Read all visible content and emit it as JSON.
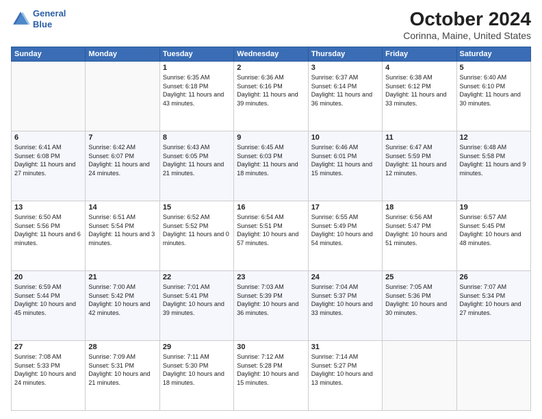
{
  "header": {
    "logo_line1": "General",
    "logo_line2": "Blue",
    "month": "October 2024",
    "location": "Corinna, Maine, United States"
  },
  "weekdays": [
    "Sunday",
    "Monday",
    "Tuesday",
    "Wednesday",
    "Thursday",
    "Friday",
    "Saturday"
  ],
  "weeks": [
    [
      {
        "day": "",
        "info": ""
      },
      {
        "day": "",
        "info": ""
      },
      {
        "day": "1",
        "info": "Sunrise: 6:35 AM\nSunset: 6:18 PM\nDaylight: 11 hours and 43 minutes."
      },
      {
        "day": "2",
        "info": "Sunrise: 6:36 AM\nSunset: 6:16 PM\nDaylight: 11 hours and 39 minutes."
      },
      {
        "day": "3",
        "info": "Sunrise: 6:37 AM\nSunset: 6:14 PM\nDaylight: 11 hours and 36 minutes."
      },
      {
        "day": "4",
        "info": "Sunrise: 6:38 AM\nSunset: 6:12 PM\nDaylight: 11 hours and 33 minutes."
      },
      {
        "day": "5",
        "info": "Sunrise: 6:40 AM\nSunset: 6:10 PM\nDaylight: 11 hours and 30 minutes."
      }
    ],
    [
      {
        "day": "6",
        "info": "Sunrise: 6:41 AM\nSunset: 6:08 PM\nDaylight: 11 hours and 27 minutes."
      },
      {
        "day": "7",
        "info": "Sunrise: 6:42 AM\nSunset: 6:07 PM\nDaylight: 11 hours and 24 minutes."
      },
      {
        "day": "8",
        "info": "Sunrise: 6:43 AM\nSunset: 6:05 PM\nDaylight: 11 hours and 21 minutes."
      },
      {
        "day": "9",
        "info": "Sunrise: 6:45 AM\nSunset: 6:03 PM\nDaylight: 11 hours and 18 minutes."
      },
      {
        "day": "10",
        "info": "Sunrise: 6:46 AM\nSunset: 6:01 PM\nDaylight: 11 hours and 15 minutes."
      },
      {
        "day": "11",
        "info": "Sunrise: 6:47 AM\nSunset: 5:59 PM\nDaylight: 11 hours and 12 minutes."
      },
      {
        "day": "12",
        "info": "Sunrise: 6:48 AM\nSunset: 5:58 PM\nDaylight: 11 hours and 9 minutes."
      }
    ],
    [
      {
        "day": "13",
        "info": "Sunrise: 6:50 AM\nSunset: 5:56 PM\nDaylight: 11 hours and 6 minutes."
      },
      {
        "day": "14",
        "info": "Sunrise: 6:51 AM\nSunset: 5:54 PM\nDaylight: 11 hours and 3 minutes."
      },
      {
        "day": "15",
        "info": "Sunrise: 6:52 AM\nSunset: 5:52 PM\nDaylight: 11 hours and 0 minutes."
      },
      {
        "day": "16",
        "info": "Sunrise: 6:54 AM\nSunset: 5:51 PM\nDaylight: 10 hours and 57 minutes."
      },
      {
        "day": "17",
        "info": "Sunrise: 6:55 AM\nSunset: 5:49 PM\nDaylight: 10 hours and 54 minutes."
      },
      {
        "day": "18",
        "info": "Sunrise: 6:56 AM\nSunset: 5:47 PM\nDaylight: 10 hours and 51 minutes."
      },
      {
        "day": "19",
        "info": "Sunrise: 6:57 AM\nSunset: 5:45 PM\nDaylight: 10 hours and 48 minutes."
      }
    ],
    [
      {
        "day": "20",
        "info": "Sunrise: 6:59 AM\nSunset: 5:44 PM\nDaylight: 10 hours and 45 minutes."
      },
      {
        "day": "21",
        "info": "Sunrise: 7:00 AM\nSunset: 5:42 PM\nDaylight: 10 hours and 42 minutes."
      },
      {
        "day": "22",
        "info": "Sunrise: 7:01 AM\nSunset: 5:41 PM\nDaylight: 10 hours and 39 minutes."
      },
      {
        "day": "23",
        "info": "Sunrise: 7:03 AM\nSunset: 5:39 PM\nDaylight: 10 hours and 36 minutes."
      },
      {
        "day": "24",
        "info": "Sunrise: 7:04 AM\nSunset: 5:37 PM\nDaylight: 10 hours and 33 minutes."
      },
      {
        "day": "25",
        "info": "Sunrise: 7:05 AM\nSunset: 5:36 PM\nDaylight: 10 hours and 30 minutes."
      },
      {
        "day": "26",
        "info": "Sunrise: 7:07 AM\nSunset: 5:34 PM\nDaylight: 10 hours and 27 minutes."
      }
    ],
    [
      {
        "day": "27",
        "info": "Sunrise: 7:08 AM\nSunset: 5:33 PM\nDaylight: 10 hours and 24 minutes."
      },
      {
        "day": "28",
        "info": "Sunrise: 7:09 AM\nSunset: 5:31 PM\nDaylight: 10 hours and 21 minutes."
      },
      {
        "day": "29",
        "info": "Sunrise: 7:11 AM\nSunset: 5:30 PM\nDaylight: 10 hours and 18 minutes."
      },
      {
        "day": "30",
        "info": "Sunrise: 7:12 AM\nSunset: 5:28 PM\nDaylight: 10 hours and 15 minutes."
      },
      {
        "day": "31",
        "info": "Sunrise: 7:14 AM\nSunset: 5:27 PM\nDaylight: 10 hours and 13 minutes."
      },
      {
        "day": "",
        "info": ""
      },
      {
        "day": "",
        "info": ""
      }
    ]
  ]
}
